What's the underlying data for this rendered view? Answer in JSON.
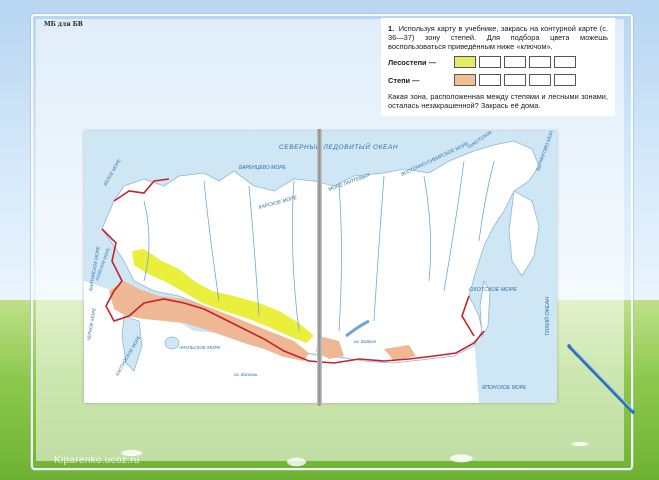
{
  "header": {
    "tiny_label": "МБ для БВ"
  },
  "task": {
    "number": "1.",
    "text": "Используя карту в учебнике, закрась на контурной карте (с. 36—37) зону степей. Для подбора цвета можешь воспользоваться приведённым ниже «ключом».",
    "key": [
      {
        "label": "Лесостепи —",
        "color": "#e3ea63",
        "empty_boxes": 4
      },
      {
        "label": "Степи —",
        "color": "#efbf93",
        "empty_boxes": 4
      }
    ],
    "question": "Какая зона, расположенная между степями и лесными зонами, осталась незакрашенной? Закрась её дома."
  },
  "map": {
    "colors": {
      "sea": "#cfe6f5",
      "land": "#ffffff",
      "forest_steppe": "#e9ef3a",
      "steppe": "#eeb894",
      "border": "#c8202a",
      "rivers": "#6fa7d3"
    },
    "labels": {
      "arctic": "СЕВЕРНЫЙ ЛЕДОВИТЫЙ ОКЕАН",
      "barents": "БАРЕНЦЕВО МОРЕ",
      "kara": "КАРСКОЕ МОРЕ",
      "laptev": "МОРЕ ЛАПТЕВЫХ",
      "east_siberian": "ВОСТОЧНО-СИБИРСКОЕ МОРЕ",
      "chukchi": "ЧУКОТСКОЕ МОРЕ",
      "bering": "БЕРИНГОВО МОРЕ",
      "okhotsk": "ОХОТСКОЕ МОРЕ",
      "pacific": "ТИХИЙ ОКЕАН",
      "japan": "ЯПОНСКОЕ МОРЕ",
      "white": "БЕЛОЕ МОРЕ",
      "baltic": "БАЛТИЙСКОЕ МОРЕ",
      "black": "ЧЕРНОЕ МОРЕ",
      "azov": "АЗОВСКОЕ МОРЕ",
      "caspian": "КАСПИЙСКОЕ МОРЕ",
      "aral": "АРАЛЬСКОЕ МОРЕ",
      "baikal": "оз. Байкал",
      "balkhash": "оз. Балхаш"
    }
  },
  "footer": {
    "watermark": "Kiparenko.ucoz.ru"
  }
}
